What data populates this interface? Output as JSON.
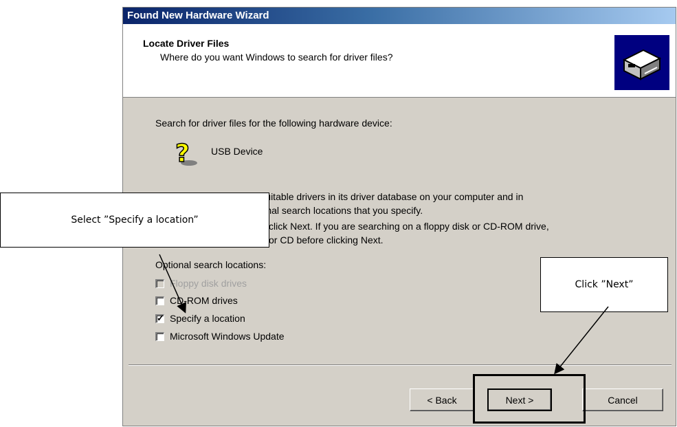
{
  "window": {
    "title": "Found New Hardware Wizard"
  },
  "header": {
    "title": "Locate Driver Files",
    "subtitle": "Where do you want Windows to search for driver files?",
    "icon": "hardware-wizard-icon"
  },
  "content": {
    "intro": "Search for driver files for the following hardware device:",
    "device_name": "USB Device",
    "device_icon": "unknown-device-question-icon",
    "paragraph_line1": "The wizard searches for suitable drivers in its driver database on your computer and in",
    "paragraph_line2_visible": "optional search locations that you specify.",
    "paragraph_line3_visible": "click Next. If you are searching on a floppy disk or CD-ROM drive,",
    "paragraph_line4_visible": "or CD before clicking Next.",
    "optional_label": "Optional search locations:",
    "options": [
      {
        "label": "Floppy disk drives",
        "checked": false,
        "enabled": false
      },
      {
        "label": "CD-ROM drives",
        "checked": false,
        "enabled": true
      },
      {
        "label": "Specify a location",
        "checked": true,
        "enabled": true
      },
      {
        "label": "Microsoft Windows Update",
        "checked": false,
        "enabled": true
      }
    ]
  },
  "buttons": {
    "back": "< Back",
    "next": "Next >",
    "cancel": "Cancel"
  },
  "annotations": {
    "select_callout": "Select ”Specify a location”",
    "next_callout": "Click ”Next”"
  },
  "colors": {
    "title_gradient_start": "#0a246a",
    "title_gradient_end": "#a6caf0",
    "dialog_face": "#d4d0c8"
  }
}
